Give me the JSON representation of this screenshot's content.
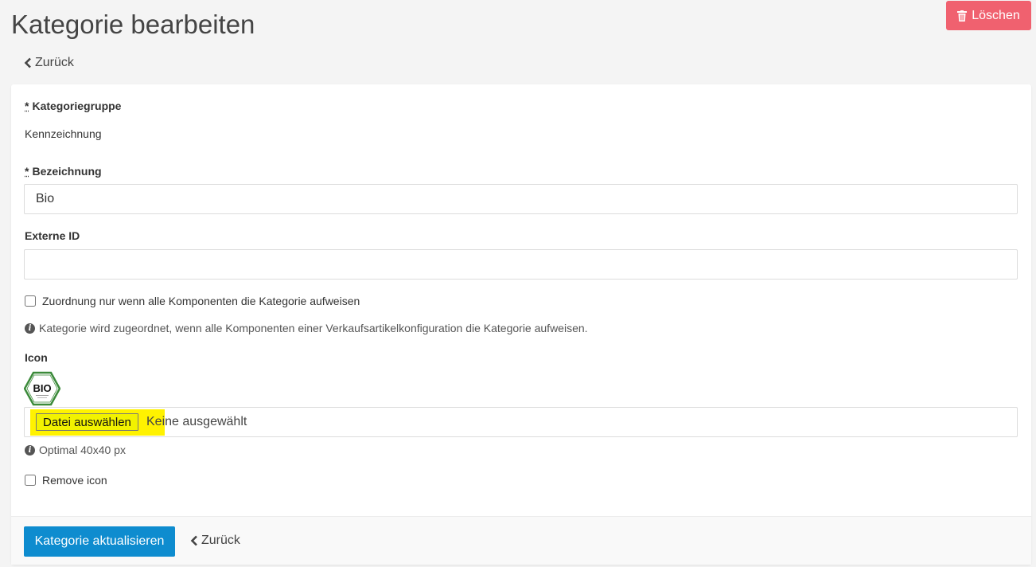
{
  "header": {
    "title": "Kategorie bearbeiten",
    "delete_label": "Löschen",
    "back_label": "Zurück"
  },
  "form": {
    "category_group": {
      "required_mark": "*",
      "label": "Kategoriegruppe",
      "value": "Kennzeichnung"
    },
    "name": {
      "required_mark": "*",
      "label": "Bezeichnung",
      "value": "Bio"
    },
    "external_id": {
      "label": "Externe ID",
      "value": ""
    },
    "assignment_checkbox": {
      "label": "Zuordnung nur wenn alle Komponenten die Kategorie aufweisen",
      "checked": false
    },
    "assignment_help": "Kategorie wird zugeordnet, wenn alle Komponenten einer Verkaufsartikelkonfiguration die Kategorie aufweisen.",
    "icon": {
      "label": "Icon",
      "logo_text": "BIO",
      "file_button_label": "Datei auswählen",
      "file_status": "Keine ausgewählt",
      "help": "Optimal 40x40 px"
    },
    "remove_icon_checkbox": {
      "label": "Remove icon",
      "checked": false
    }
  },
  "footer": {
    "submit_label": "Kategorie aktualisieren",
    "back_label": "Zurück"
  },
  "colors": {
    "delete": "#f0616f",
    "primary": "#0e8ccf",
    "highlight": "#fff200",
    "bio_green": "#3b8a3a"
  }
}
